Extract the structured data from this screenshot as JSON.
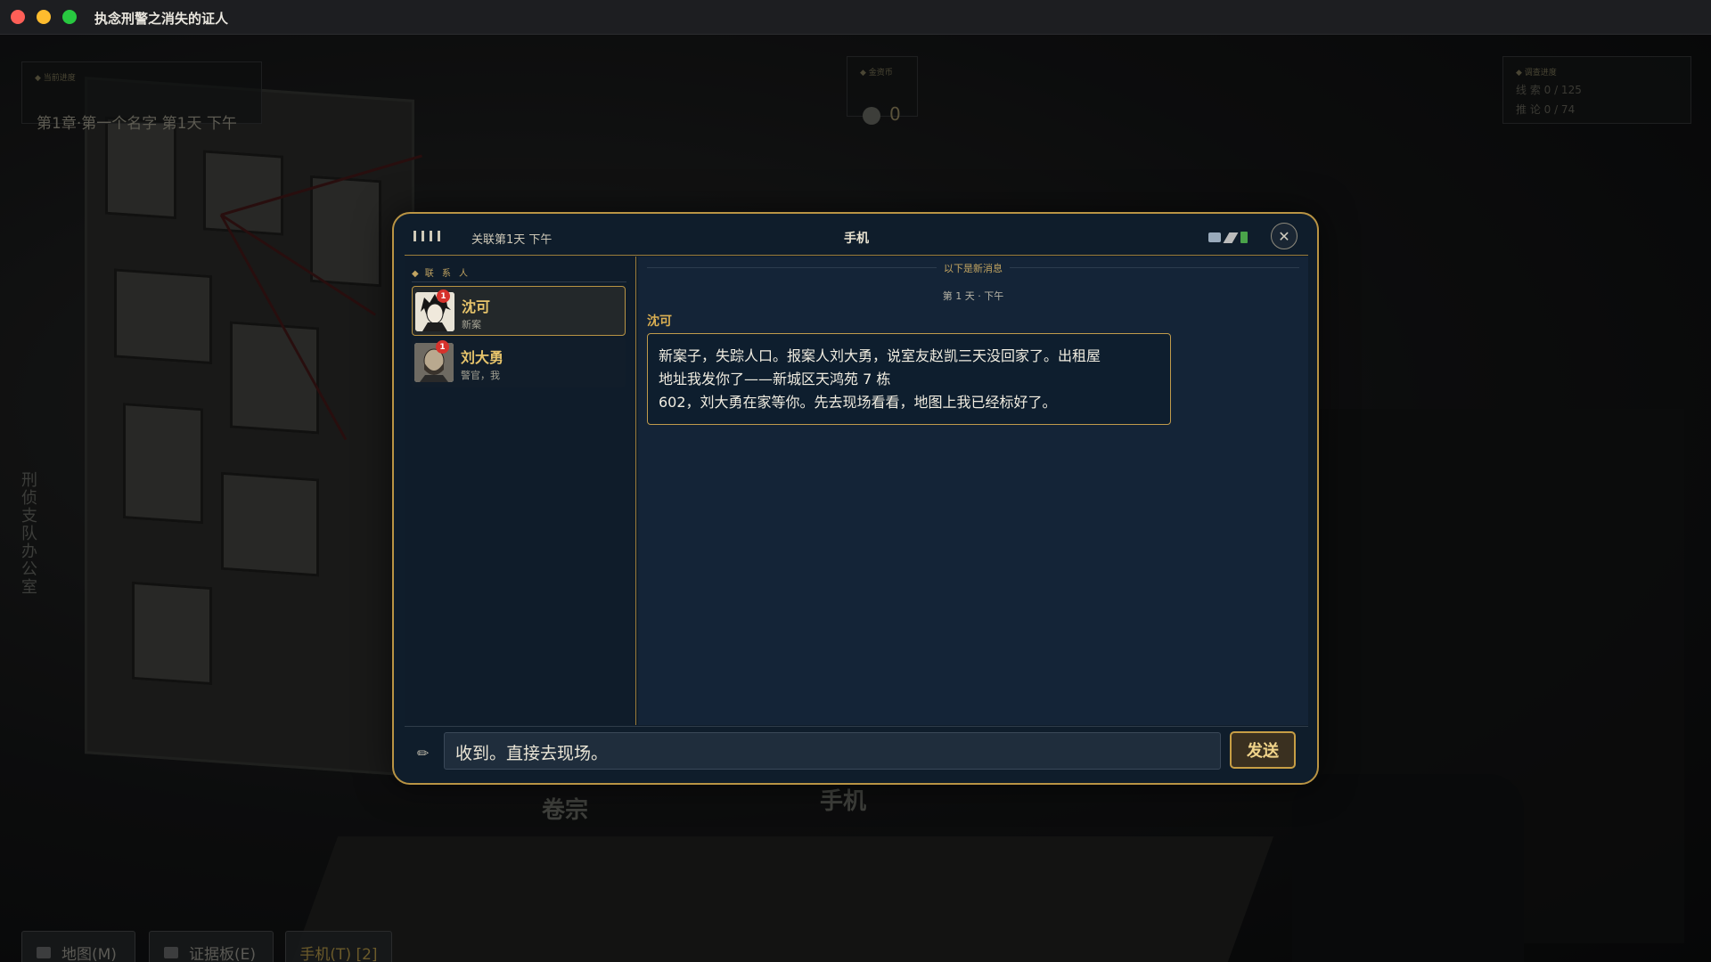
{
  "window": {
    "title": "执念刑警之消失的证人"
  },
  "hud": {
    "chapter_label": "◆ 当前进度",
    "chapter_text": "第1章·第一个名字  第1天 下午",
    "coin_label": "◆ 金资币",
    "coin_value": "0",
    "progress_label": "◆ 调查进度",
    "clues_text": "线 索   0 / 125",
    "deduction_text": "推 论   0 / 74"
  },
  "scene": {
    "wall_sign": "刑侦支队办公室",
    "label_files": "卷宗",
    "label_phone": "手机"
  },
  "bottom_bar": {
    "map_label": "地图(M)",
    "evidence_label": "证据板(E)",
    "phone_label": "手机(T) [2]"
  },
  "phone": {
    "signal_bars": 4,
    "status_time": "关联第1天 下午",
    "title": "手机",
    "close_symbol": "✕",
    "contacts_header": "联 系 人",
    "contacts": [
      {
        "name": "沈可",
        "subtitle": "新案",
        "badge": "1",
        "active": true
      },
      {
        "name": "刘大勇",
        "subtitle": "警官，我",
        "badge": "1",
        "active": false
      }
    ],
    "chat": {
      "new_divider": "以下是新消息",
      "day_label": "第 1 天 · 下午",
      "sender": "沈可",
      "message_line1": "新案子，失踪人口。报案人刘大勇，说室友赵凯三天没回家了。出租屋",
      "message_line2": "地址我发你了——新城区天鸿苑 7 栋",
      "message_line3": "602，刘大勇在家等你。先去现场看看，地图上我已经标好了。"
    },
    "input_value": "收到。直接去现场。",
    "pencil_icon": "✏",
    "send_label": "发送"
  }
}
